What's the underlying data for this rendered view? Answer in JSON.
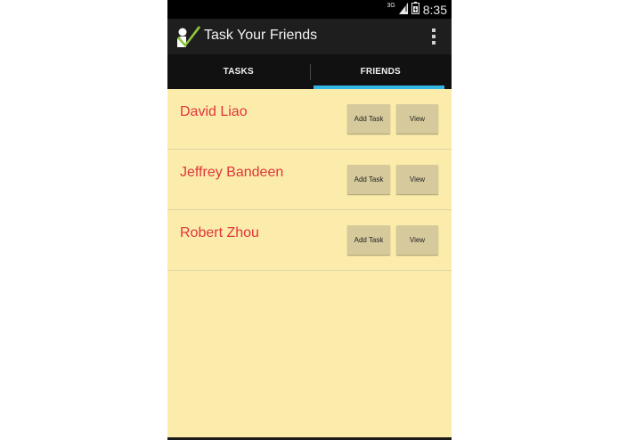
{
  "status_bar": {
    "network_label": "3G",
    "time": "8:35"
  },
  "action_bar": {
    "app_icon": "checkmark-person-icon",
    "title": "Task Your Friends",
    "overflow_icon": "overflow-menu-icon"
  },
  "tabs": [
    {
      "label": "TASKS",
      "selected": false
    },
    {
      "label": "FRIENDS",
      "selected": true
    }
  ],
  "colors": {
    "background": "#fcecab",
    "friend_name": "#e0353a",
    "tab_indicator": "#33b5e5",
    "button": "#d6c99c"
  },
  "friends": [
    {
      "name": "David Liao",
      "add_label": "Add Task",
      "view_label": "View"
    },
    {
      "name": "Jeffrey Bandeen",
      "add_label": "Add Task",
      "view_label": "View"
    },
    {
      "name": "Robert Zhou",
      "add_label": "Add Task",
      "view_label": "View"
    }
  ]
}
